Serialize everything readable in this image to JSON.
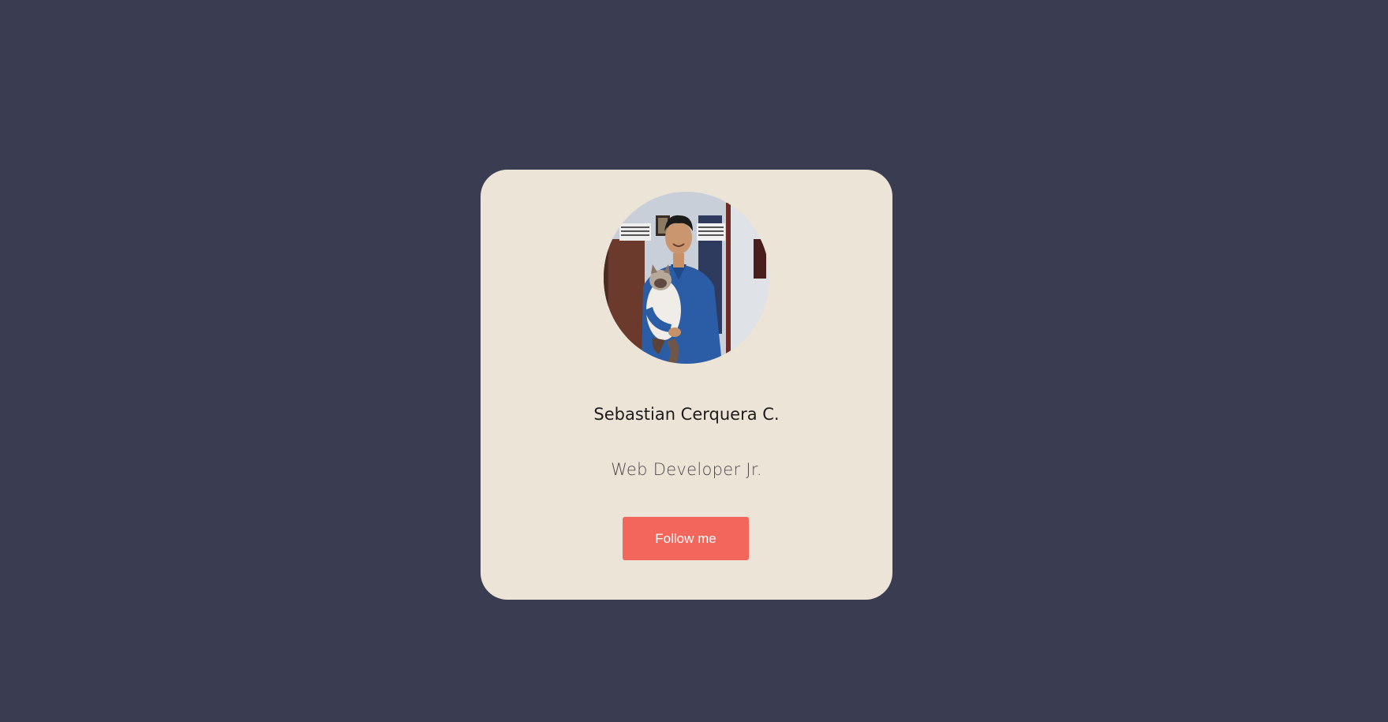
{
  "profile_card": {
    "name": "Sebastian Cerquera C.",
    "role": "Web Developer Jr.",
    "follow_label": "Follow me",
    "avatar_icon": "profile-photo"
  },
  "colors": {
    "background": "#3a3d52",
    "card": "#ede4d8",
    "accent": "#f2665b",
    "name_text": "#1c1c1c",
    "role_text": "#4b4b4b"
  }
}
